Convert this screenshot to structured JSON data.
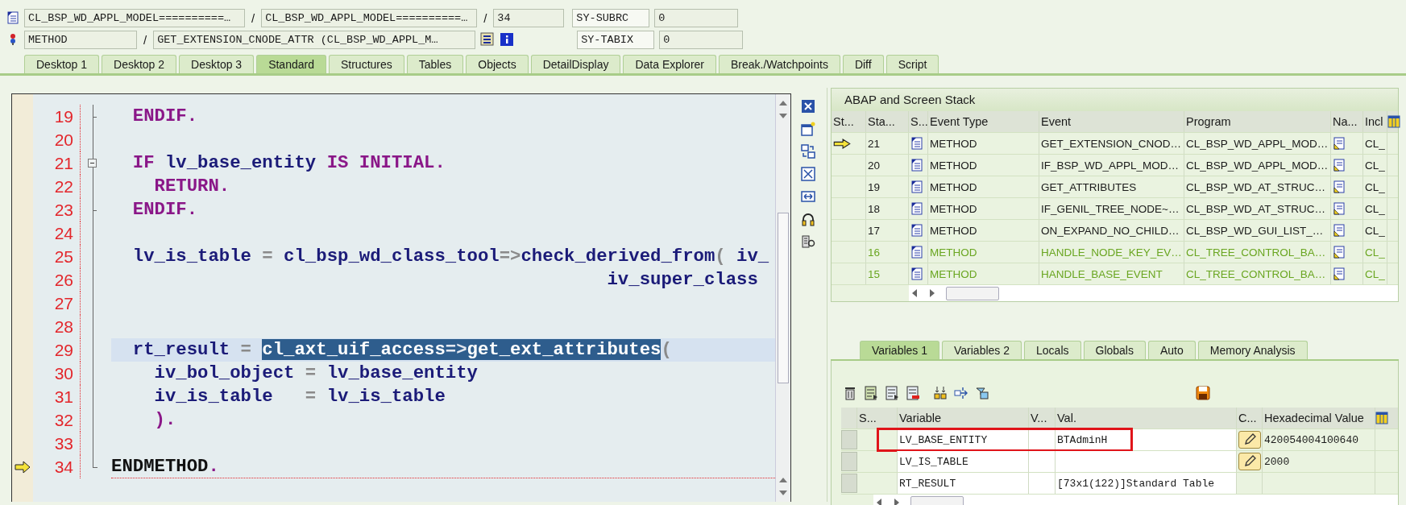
{
  "program_row": {
    "include": "CL_BSP_WD_APPL_MODEL==========…",
    "separators": [
      "/",
      "/"
    ],
    "program": "CL_BSP_WD_APPL_MODEL==========…",
    "line": "34",
    "field_name": "SY-SUBRC",
    "field_value": "0"
  },
  "event_row": {
    "event_type": "METHOD",
    "separator": "/",
    "event": "GET_EXTENSION_CNODE_ATTR (CL_BSP_WD_APPL_M…",
    "field_name": "SY-TABIX",
    "field_value": "0"
  },
  "tabs": [
    {
      "label": "Desktop 1",
      "selected": false
    },
    {
      "label": "Desktop 2",
      "selected": false
    },
    {
      "label": "Desktop 3",
      "selected": false
    },
    {
      "label": "Standard",
      "selected": true
    },
    {
      "label": "Structures",
      "selected": false
    },
    {
      "label": "Tables",
      "selected": false
    },
    {
      "label": "Objects",
      "selected": false
    },
    {
      "label": "DetailDisplay",
      "selected": false
    },
    {
      "label": "Data Explorer",
      "selected": false
    },
    {
      "label": "Break./Watchpoints",
      "selected": false
    },
    {
      "label": "Diff",
      "selected": false
    },
    {
      "label": "Script",
      "selected": false
    }
  ],
  "editor": {
    "lines": [
      {
        "number": "19",
        "kind": "close",
        "current": false,
        "highlighted": false,
        "tokens": [
          {
            "text": "  ENDIF.",
            "kind": "keyword",
            "selected": false
          }
        ]
      },
      {
        "number": "20",
        "kind": "code",
        "current": false,
        "highlighted": false
      },
      {
        "number": "21",
        "kind": "open",
        "current": false,
        "highlighted": false,
        "tokens": [
          {
            "text": "  IF",
            "kind": "keyword",
            "selected": false
          },
          {
            "text": " lv_base_entity ",
            "kind": "ident",
            "selected": false
          },
          {
            "text": "IS INITIAL.",
            "kind": "keyword",
            "selected": false
          }
        ]
      },
      {
        "number": "22",
        "kind": "code",
        "current": false,
        "highlighted": false,
        "tokens": [
          {
            "text": "    RETURN.",
            "kind": "keyword",
            "selected": false
          }
        ]
      },
      {
        "number": "23",
        "kind": "close",
        "current": false,
        "highlighted": false,
        "tokens": [
          {
            "text": "  ENDIF.",
            "kind": "keyword",
            "selected": false
          }
        ]
      },
      {
        "number": "24",
        "kind": "code",
        "current": false,
        "highlighted": false
      },
      {
        "number": "25",
        "kind": "code",
        "current": false,
        "highlighted": false,
        "tokens": [
          {
            "text": "  lv_is_table",
            "kind": "ident",
            "selected": false
          },
          {
            "text": " = ",
            "kind": "operator",
            "selected": false
          },
          {
            "text": "cl_bsp_wd_class_tool",
            "kind": "ident",
            "selected": false
          },
          {
            "text": "=>",
            "kind": "operator",
            "selected": false
          },
          {
            "text": "check_derived_from",
            "kind": "ident",
            "selected": false
          },
          {
            "text": "( ",
            "kind": "operator",
            "selected": false
          },
          {
            "text": "iv_",
            "kind": "ident",
            "selected": false
          }
        ]
      },
      {
        "number": "26",
        "kind": "code",
        "current": false,
        "highlighted": false,
        "tokens": [
          {
            "text": "                                              iv_super_class",
            "kind": "ident",
            "selected": false
          }
        ]
      },
      {
        "number": "27",
        "kind": "code",
        "current": false,
        "highlighted": false
      },
      {
        "number": "28",
        "kind": "code",
        "current": false,
        "highlighted": false
      },
      {
        "number": "29",
        "kind": "code",
        "current": false,
        "highlighted": true,
        "tokens": [
          {
            "text": "  rt_result",
            "kind": "ident",
            "selected": false
          },
          {
            "text": " = ",
            "kind": "operator",
            "selected": false
          },
          {
            "text": "cl_axt_uif_access",
            "kind": "ident",
            "selected": true
          },
          {
            "text": "=>",
            "kind": "operator",
            "selected": true
          },
          {
            "text": "get_ext_attributes",
            "kind": "ident",
            "selected": true
          },
          {
            "text": "(",
            "kind": "operator",
            "selected": false
          }
        ]
      },
      {
        "number": "30",
        "kind": "code",
        "current": false,
        "highlighted": false,
        "tokens": [
          {
            "text": "    iv_bol_object",
            "kind": "ident",
            "selected": false
          },
          {
            "text": " = ",
            "kind": "operator",
            "selected": false
          },
          {
            "text": "lv_base_entity",
            "kind": "ident",
            "selected": false
          }
        ]
      },
      {
        "number": "31",
        "kind": "code",
        "current": false,
        "highlighted": false,
        "tokens": [
          {
            "text": "    iv_is_table",
            "kind": "ident",
            "selected": false
          },
          {
            "text": "   = ",
            "kind": "operator",
            "selected": false
          },
          {
            "text": "lv_is_table",
            "kind": "ident",
            "selected": false
          }
        ]
      },
      {
        "number": "32",
        "kind": "code",
        "current": false,
        "highlighted": false,
        "tokens": [
          {
            "text": "    ).",
            "kind": "keyword",
            "selected": false
          }
        ]
      },
      {
        "number": "33",
        "kind": "code",
        "current": false,
        "highlighted": false
      },
      {
        "number": "34",
        "kind": "end",
        "current": true,
        "highlighted": false,
        "tokens": [
          {
            "text": "ENDMETHOD",
            "kind": "plain",
            "selected": false
          },
          {
            "text": ".",
            "kind": "keyword",
            "selected": false
          }
        ]
      }
    ]
  },
  "stack": {
    "title": "ABAP and Screen Stack",
    "columns": [
      "St...",
      "Sta...",
      "S...",
      "Event Type",
      "Event",
      "Program",
      "Na...",
      "Incl"
    ],
    "rows": [
      {
        "current": true,
        "level": "21",
        "event_type": "METHOD",
        "event": "GET_EXTENSION_CNOD…",
        "program": "CL_BSP_WD_APPL_MOD…",
        "include": "CL_",
        "kind": "normal"
      },
      {
        "current": false,
        "level": "20",
        "event_type": "METHOD",
        "event": "IF_BSP_WD_APPL_MOD…",
        "program": "CL_BSP_WD_APPL_MOD…",
        "include": "CL_",
        "kind": "normal"
      },
      {
        "current": false,
        "level": "19",
        "event_type": "METHOD",
        "event": "GET_ATTRIBUTES",
        "program": "CL_BSP_WD_AT_STRUC…",
        "include": "CL_",
        "kind": "normal"
      },
      {
        "current": false,
        "level": "18",
        "event_type": "METHOD",
        "event": "IF_GENIL_TREE_NODE~…",
        "program": "CL_BSP_WD_AT_STRUC…",
        "include": "CL_",
        "kind": "normal"
      },
      {
        "current": false,
        "level": "17",
        "event_type": "METHOD",
        "event": "ON_EXPAND_NO_CHILD…",
        "program": "CL_BSP_WD_GUI_LIST_…",
        "include": "CL_",
        "kind": "normal"
      },
      {
        "current": false,
        "level": "16",
        "event_type": "METHOD",
        "event": "HANDLE_NODE_KEY_EV…",
        "program": "CL_TREE_CONTROL_BA…",
        "include": "CL_",
        "kind": "system"
      },
      {
        "current": false,
        "level": "15",
        "event_type": "METHOD",
        "event": "HANDLE_BASE_EVENT",
        "program": "CL_TREE_CONTROL_BA…",
        "include": "CL_",
        "kind": "system"
      }
    ]
  },
  "variables": {
    "tabs": [
      {
        "label": "Variables 1",
        "selected": true
      },
      {
        "label": "Variables 2",
        "selected": false
      },
      {
        "label": "Locals",
        "selected": false
      },
      {
        "label": "Globals",
        "selected": false
      },
      {
        "label": "Auto",
        "selected": false
      },
      {
        "label": "Memory Analysis",
        "selected": false
      }
    ],
    "columns": [
      "S...",
      "Variable",
      "V...",
      "Val.",
      "C...",
      "Hexadecimal Value"
    ],
    "rows": [
      {
        "variable": "LV_BASE_ENTITY",
        "value": "BTAdminH",
        "editable": true,
        "hex": "420054004100640",
        "annotated": true
      },
      {
        "variable": "LV_IS_TABLE",
        "editable": true,
        "hex": "2000",
        "annotated": false
      },
      {
        "variable": "RT_RESULT",
        "value": "[73x1(122)]Standard Table",
        "editable": false,
        "annotated": false
      }
    ]
  }
}
